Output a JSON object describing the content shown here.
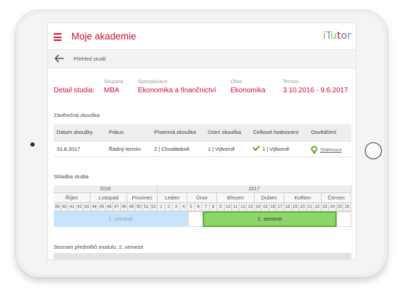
{
  "app": {
    "title": "Moje akademie",
    "logo": [
      "i",
      "T",
      "u",
      "t",
      "o",
      "r"
    ]
  },
  "subbar": {
    "title": "Přehled studií"
  },
  "detail": {
    "heading": "Detail studia:",
    "fields": [
      {
        "label": "Skupina",
        "value": "MBA"
      },
      {
        "label": "Specializace",
        "value": "Ekonomika a finančnictví"
      },
      {
        "label": "Obor",
        "value": "Ekonomika"
      },
      {
        "label": "Termín",
        "value": "3.10.2016 - 9.6.2017"
      }
    ]
  },
  "exam": {
    "title": "Závěrečná zkouška",
    "headers": [
      "Datum zkoušky",
      "Pokus",
      "Písemná zkouška",
      "Ústní zkouška",
      "Celkové hodnocení",
      "Osvědčení"
    ],
    "row": {
      "date": "31.8.2017",
      "attempt": "Řádný termín",
      "written": "2 | Chvalitebně",
      "oral": "1 | Výborně",
      "total": "1 | Výborně",
      "certificate": "Stáhnout"
    }
  },
  "timeline": {
    "title": "Skladba studia",
    "years": [
      "2016",
      "2017"
    ],
    "months": [
      "Říjen",
      "Listopad",
      "Prosinec",
      "Leden",
      "Únor",
      "Březen",
      "Duben",
      "Květen",
      "Červen"
    ],
    "weeks": [
      "39",
      "40",
      "41",
      "42",
      "43",
      "44",
      "45",
      "46",
      "47",
      "48",
      "49",
      "50",
      "51",
      "52",
      "1",
      "2",
      "3",
      "4",
      "5",
      "6",
      "7",
      "8",
      "9",
      "10",
      "11",
      "12",
      "13",
      "14",
      "15",
      "16",
      "17",
      "18",
      "19",
      "20",
      "21",
      "22",
      "23",
      "24",
      "25",
      "26"
    ],
    "semesters": [
      "1. semestr",
      "2. semestr"
    ]
  },
  "modules": {
    "title": "Seznam předmětů modulu: 2. semestr"
  }
}
